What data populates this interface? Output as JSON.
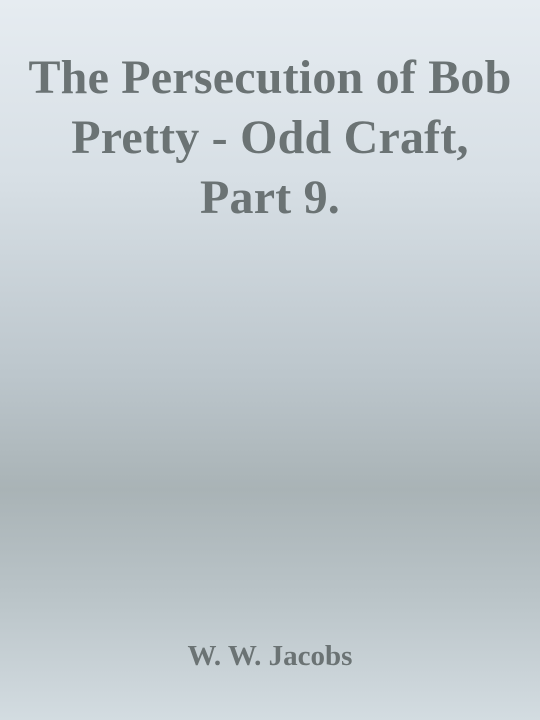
{
  "cover": {
    "title": "The Persecution of Bob Pretty - Odd Craft, Part 9.",
    "author": "W. W. Jacobs",
    "colors": {
      "text": "#6b7374",
      "background_top": "#e6ecf1",
      "background_middle": "#a9b3b6",
      "background_bottom": "#d3dce1"
    }
  }
}
